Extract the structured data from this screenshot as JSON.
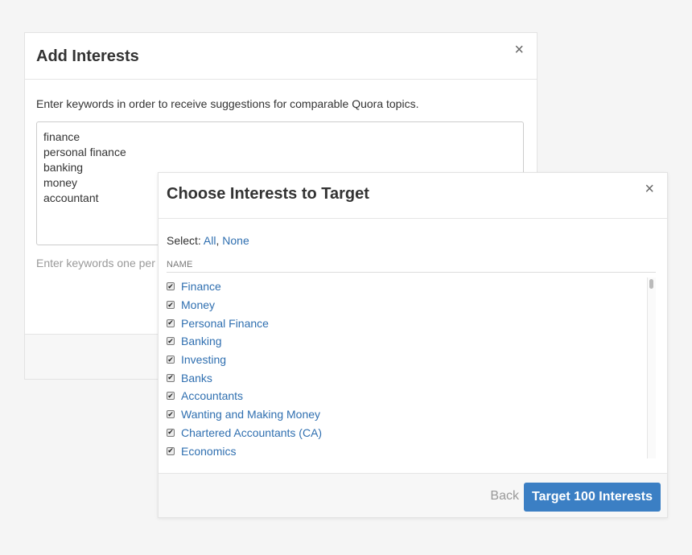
{
  "add_modal": {
    "title": "Add Interests",
    "close_glyph": "×",
    "description": "Enter keywords in order to receive suggestions for comparable Quora topics.",
    "keywords_value": "finance\npersonal finance\nbanking\nmoney\naccountant",
    "hint": "Enter keywords one per li"
  },
  "choose_modal": {
    "title": "Choose Interests to Target",
    "close_glyph": "×",
    "select_label": "Select: ",
    "select_all": "All",
    "select_separator": ", ",
    "select_none": "None",
    "column_header": "NAME",
    "check_glyph": "✔",
    "items": [
      "Finance",
      "Money",
      "Personal Finance",
      "Banking",
      "Investing",
      "Banks",
      "Accountants",
      "Wanting and Making Money",
      "Chartered Accountants (CA)",
      "Economics"
    ],
    "back_label": "Back",
    "primary_label": "Target 100 Interests"
  },
  "icons": {
    "close": "close-icon",
    "checkbox": "checkbox-checked-icon"
  },
  "colors": {
    "link": "#2f6fb0",
    "primary": "#3b7fc4",
    "background": "#f5f5f5"
  }
}
